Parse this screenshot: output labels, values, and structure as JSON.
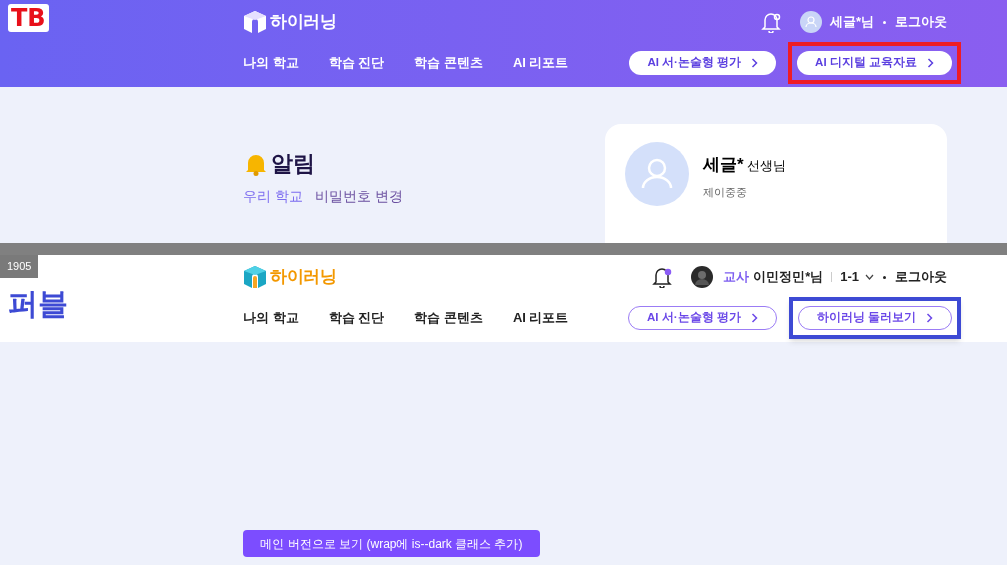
{
  "versions": [
    {
      "kind": "purple",
      "tag": "TB",
      "logo": "하이러닝",
      "notifications": {
        "unread": true
      },
      "user": {
        "name": "세글*님"
      },
      "logout": "로그아웃",
      "nav": [
        "나의 학교",
        "학습 진단",
        "학습 콘텐츠",
        "AI 리포트"
      ],
      "buttons": [
        {
          "label": "AI 서·논술형 평가",
          "highlighted": false
        },
        {
          "label": "AI 디지털 교육자료",
          "highlighted": true
        }
      ],
      "content": {
        "kind": "notice",
        "title": "알림",
        "links": [
          {
            "label": "우리 학교",
            "selected": true
          },
          {
            "label": "비밀번호 변경",
            "selected": false
          }
        ],
        "profile": {
          "name": "세글*",
          "suffix": "선생님",
          "school": "제이중중"
        }
      }
    },
    {
      "kind": "white",
      "version_label": "1905",
      "tag": "퍼블",
      "logo": "하이러닝",
      "notifications": {
        "unread": true
      },
      "user": {
        "role": "교사",
        "name": "이민정민*님",
        "class": "1-1"
      },
      "logout": "로그아웃",
      "nav": [
        "나의 학교",
        "학습 진단",
        "학습 콘텐츠",
        "AI 리포트"
      ],
      "buttons": [
        {
          "label": "AI 서·논술형 평가",
          "highlighted": false
        },
        {
          "label": "하이러닝 둘러보기",
          "highlighted": true
        }
      ],
      "content": {
        "kind": "blank",
        "footer_button": "메인 버전으로 보기 (wrap에 is--dark 클래스 추가)"
      }
    }
  ]
}
